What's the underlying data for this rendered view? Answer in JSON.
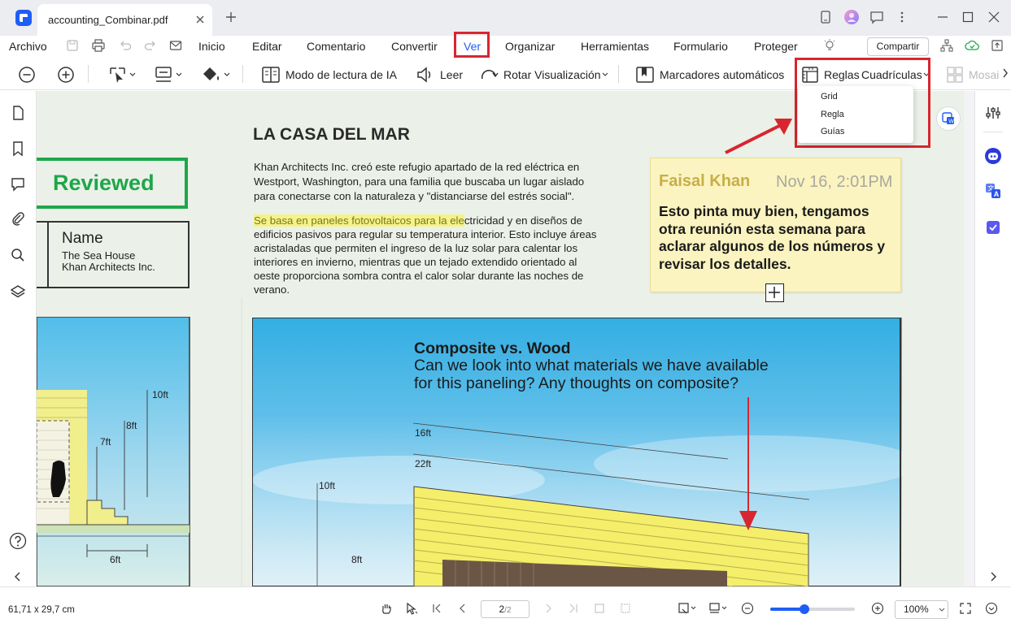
{
  "window": {
    "tab_title": "accounting_Combinar.pdf"
  },
  "menu": {
    "archivo": "Archivo",
    "items": [
      "Inicio",
      "Editar",
      "Comentario",
      "Convertir",
      "Ver",
      "Organizar",
      "Herramientas",
      "Formulario",
      "Proteger"
    ],
    "active": "Ver",
    "share_label": "Compartir"
  },
  "toolbar": {
    "ai_reading": "Modo de lectura de IA",
    "read": "Leer",
    "rotate": "Rotar Visualización",
    "bookmarks": "Marcadores automáticos",
    "rulers": "Reglas",
    "grids": "Cuadrículas",
    "mosaic": "Mosaic"
  },
  "dropdown": {
    "items": [
      "Grid",
      "Regla",
      "Guías"
    ]
  },
  "document": {
    "reviewed_stamp": "Reviewed",
    "name_label": "Name",
    "name_line1": "The Sea House",
    "name_line2": "Khan Architects Inc.",
    "title": "LA CASA DEL MAR",
    "para1": [
      "Khan Architects Inc. creó este refugio apartado de la red eléctrica en",
      "Westport, Washington, para una familia que buscaba un lugar aislado",
      "para conectarse con la naturaleza y \"distanciarse del estrés social\"."
    ],
    "para2_highlight": "Se basa en paneles fotovoltaicos para la ele",
    "para2_first_rest": "ctricidad y en diseños de",
    "para2": [
      "edificios pasivos para regular su temperatura interior. Esto incluye áreas",
      "acristaladas que permiten el ingreso de la luz solar para calentar los",
      "interiores en invierno, mientras que un tejado extendido orientado al",
      "oeste proporciona sombra contra el calor solar durante las noches de",
      "verano."
    ],
    "note_author": "Faisal Khan",
    "note_date": "Nov 16, 2:01PM",
    "note_text": [
      "Esto pinta muy bien, tengamos",
      "otra reunión esta semana para",
      "aclarar algunos de los números y",
      "revisar los detalles."
    ],
    "composite_title": "Composite vs. Wood",
    "composite_text": [
      "Can we look into what materials we have available",
      "for this paneling? Any thoughts on composite?"
    ],
    "dims_right": [
      "16ft",
      "22ft",
      "10ft",
      "8ft"
    ],
    "dims_left": [
      "10ft",
      "8ft",
      "7ft",
      "6ft"
    ]
  },
  "status": {
    "dimensions": "61,71 x 29,7 cm",
    "page_input": "2",
    "page_total": "/2",
    "zoom": "100%",
    "zoom_fraction": 0.4
  },
  "colors": {
    "accent_red": "#d7262f",
    "reviewed_green": "#1fa64a",
    "brand_blue": "#1f5ef5",
    "note_yellow": "#fbf4c0",
    "sky_blue": "#3db3e6"
  }
}
